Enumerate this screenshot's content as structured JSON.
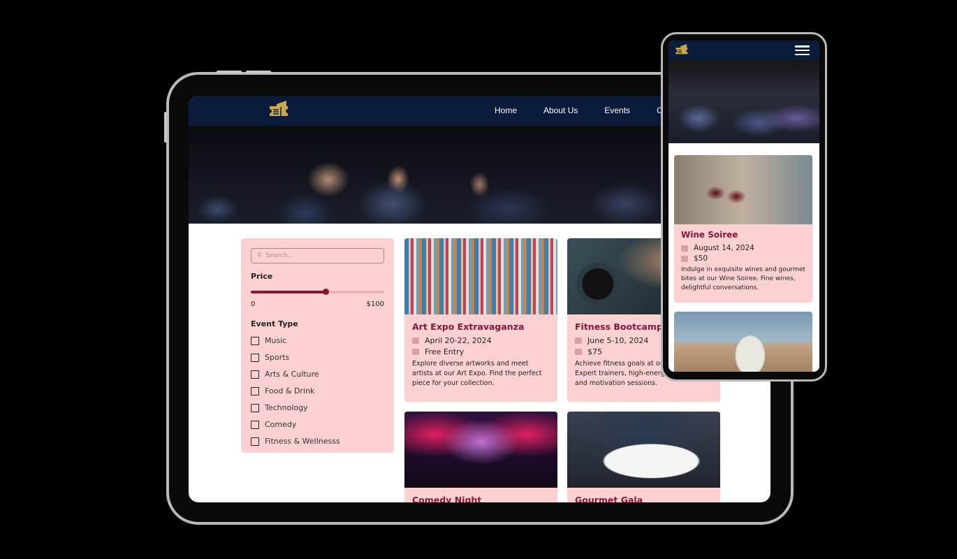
{
  "brand": {
    "logo_icon": "ticket-icon",
    "logo_color": "#c9a94e",
    "nav_color": "#0b1b3b",
    "accent": "#8a1538",
    "card_bg": "#fdd0d2"
  },
  "tablet": {
    "nav": {
      "items": [
        "Home",
        "About Us",
        "Events",
        "Co"
      ]
    },
    "filter": {
      "search_placeholder": "Search...",
      "price_label": "Price",
      "price_min": "0",
      "price_max": "$100",
      "price_value_percent": 56,
      "event_type_label": "Event Type",
      "types": [
        "Music",
        "Sports",
        "Arts & Culture",
        "Food & Drink",
        "Technology",
        "Comedy",
        "Fitness & Wellnesss"
      ]
    },
    "cards": [
      {
        "title": "Art Expo Extravaganza",
        "date": "April 20-22, 2024",
        "price": "Free Entry",
        "desc": "Explore diverse artworks and meet artists at our Art Expo. Find the perfect piece for your collection."
      },
      {
        "title": "Fitness Bootcamp",
        "date": "June 5-10, 2024",
        "price": "$75",
        "desc": "Achieve fitness goals at our Bootcamp. Expert trainers, high-energy workouts, and motivation sessions."
      },
      {
        "title": "Comedy Night"
      },
      {
        "title": "Gourmet Gala"
      }
    ]
  },
  "phone": {
    "card": {
      "title": "Wine Soiree",
      "date": "August 14, 2024",
      "price": "$50",
      "desc": "Indulge in exquisite wines and gourmet bites at our Wine Soiree. Fine wines, delightful conversations."
    }
  }
}
